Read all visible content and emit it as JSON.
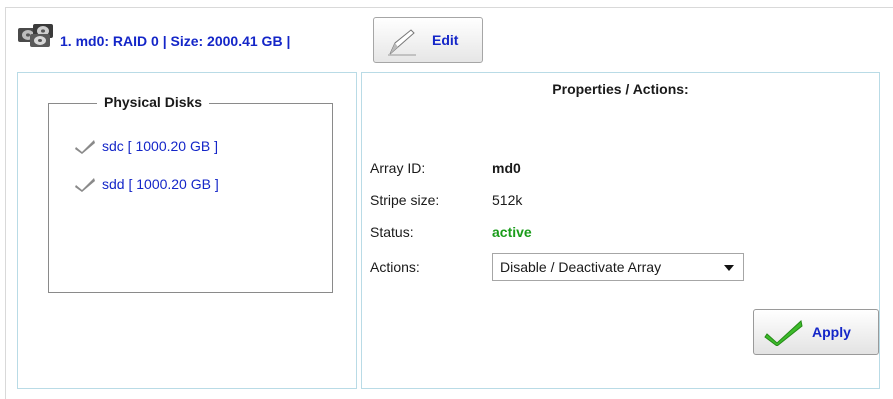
{
  "header": {
    "title": "1. md0: RAID 0 | Size: 2000.41 GB |",
    "edit_label": "Edit",
    "icon": "hard-disks-icon"
  },
  "physical_disks": {
    "legend": "Physical Disks",
    "items": [
      {
        "label": "sdc [ 1000.20 GB ]",
        "icon": "check-icon"
      },
      {
        "label": "sdd [ 1000.20 GB ]",
        "icon": "check-icon"
      }
    ]
  },
  "properties": {
    "title": "Properties / Actions:",
    "array_id_label": "Array ID:",
    "array_id_value": "md0",
    "stripe_label": "Stripe size:",
    "stripe_value": "512k",
    "status_label": "Status:",
    "status_value": "active",
    "status_color": "#1a9c1a",
    "actions_label": "Actions:",
    "actions_selected": "Disable / Deactivate Array",
    "apply_label": "Apply"
  },
  "colors": {
    "link_blue": "#1426c8",
    "panel_border": "#b9dbe6"
  }
}
